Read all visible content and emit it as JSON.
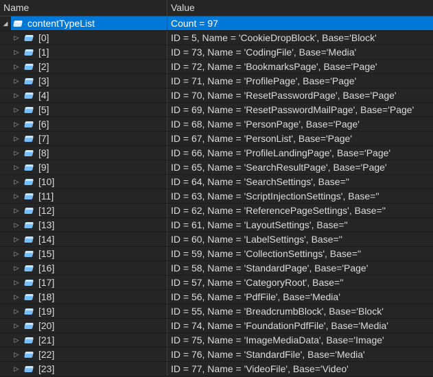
{
  "header": {
    "name": "Name",
    "value": "Value"
  },
  "root": {
    "name": "contentTypeList",
    "value": "Count = 97",
    "expanded": true,
    "selected": true
  },
  "items": [
    {
      "name": "[0]",
      "value": "ID = 5, Name = 'CookieDropBlock', Base='Block'"
    },
    {
      "name": "[1]",
      "value": "ID = 73, Name = 'CodingFile', Base='Media'"
    },
    {
      "name": "[2]",
      "value": "ID = 72, Name = 'BookmarksPage', Base='Page'"
    },
    {
      "name": "[3]",
      "value": "ID = 71, Name = 'ProfilePage', Base='Page'"
    },
    {
      "name": "[4]",
      "value": "ID = 70, Name = 'ResetPasswordPage', Base='Page'"
    },
    {
      "name": "[5]",
      "value": "ID = 69, Name = 'ResetPasswordMailPage', Base='Page'"
    },
    {
      "name": "[6]",
      "value": "ID = 68, Name = 'PersonPage', Base='Page'"
    },
    {
      "name": "[7]",
      "value": "ID = 67, Name = 'PersonList', Base='Page'"
    },
    {
      "name": "[8]",
      "value": "ID = 66, Name = 'ProfileLandingPage', Base='Page'"
    },
    {
      "name": "[9]",
      "value": "ID = 65, Name = 'SearchResultPage', Base='Page'"
    },
    {
      "name": "[10]",
      "value": "ID = 64, Name = 'SearchSettings', Base=''"
    },
    {
      "name": "[11]",
      "value": "ID = 63, Name = 'ScriptInjectionSettings', Base=''"
    },
    {
      "name": "[12]",
      "value": "ID = 62, Name = 'ReferencePageSettings', Base=''"
    },
    {
      "name": "[13]",
      "value": "ID = 61, Name = 'LayoutSettings', Base=''"
    },
    {
      "name": "[14]",
      "value": "ID = 60, Name = 'LabelSettings', Base=''"
    },
    {
      "name": "[15]",
      "value": "ID = 59, Name = 'CollectionSettings', Base=''"
    },
    {
      "name": "[16]",
      "value": "ID = 58, Name = 'StandardPage', Base='Page'"
    },
    {
      "name": "[17]",
      "value": "ID = 57, Name = 'CategoryRoot', Base=''"
    },
    {
      "name": "[18]",
      "value": "ID = 56, Name = 'PdfFile', Base='Media'"
    },
    {
      "name": "[19]",
      "value": "ID = 55, Name = 'BreadcrumbBlock', Base='Block'"
    },
    {
      "name": "[20]",
      "value": "ID = 74, Name = 'FoundationPdfFile', Base='Media'"
    },
    {
      "name": "[21]",
      "value": "ID = 75, Name = 'ImageMediaData', Base='Image'"
    },
    {
      "name": "[22]",
      "value": "ID = 76, Name = 'StandardFile', Base='Media'"
    },
    {
      "name": "[23]",
      "value": "ID = 77, Name = 'VideoFile', Base='Video'"
    }
  ],
  "colors": {
    "selection": "#0078d7",
    "icon": "#75beff",
    "background": "#252526"
  }
}
